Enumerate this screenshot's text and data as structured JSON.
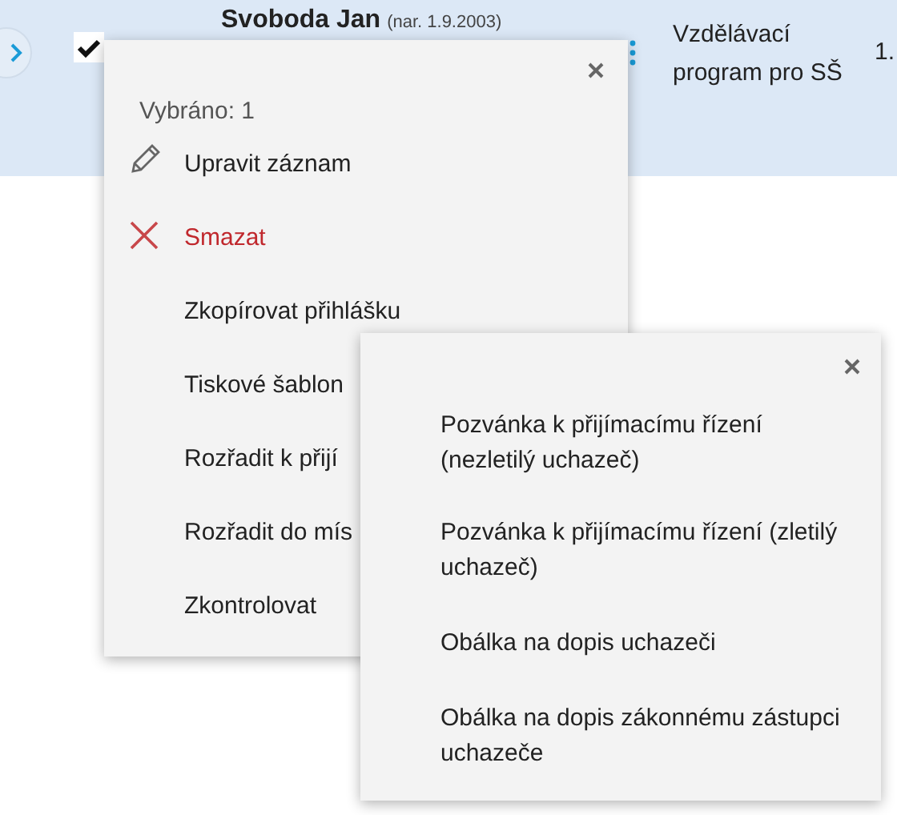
{
  "row": {
    "selected": true,
    "checked": true,
    "name": "Svoboda Jan",
    "birth": "(nar. 1.9.2003)",
    "program": "Vzdělávací program pro SŠ",
    "column_4": "1."
  },
  "menu": {
    "selected_count": "Vybráno: 1",
    "items": [
      {
        "label": "Upravit záznam",
        "kind": "edit"
      },
      {
        "label": "Smazat",
        "kind": "delete"
      },
      {
        "label": "Zkopírovat přihlášku",
        "kind": "plain"
      },
      {
        "label": "Tiskové šablon",
        "kind": "plain"
      },
      {
        "label": "Rozřadit k přijí",
        "kind": "plain"
      },
      {
        "label": "Rozřadit do mís",
        "kind": "plain"
      },
      {
        "label": "Zkontrolovat",
        "kind": "plain"
      }
    ]
  },
  "submenu": {
    "items": [
      {
        "label": "Pozvánka k přijímacímu řízení (nezletilý uchazeč)"
      },
      {
        "label": "Pozvánka k přijímacímu řízení (zletilý uchazeč)"
      },
      {
        "label": "Obálka na dopis uchazeči"
      },
      {
        "label": "Obálka na dopis zákonnému zástupci uchazeče"
      }
    ]
  }
}
